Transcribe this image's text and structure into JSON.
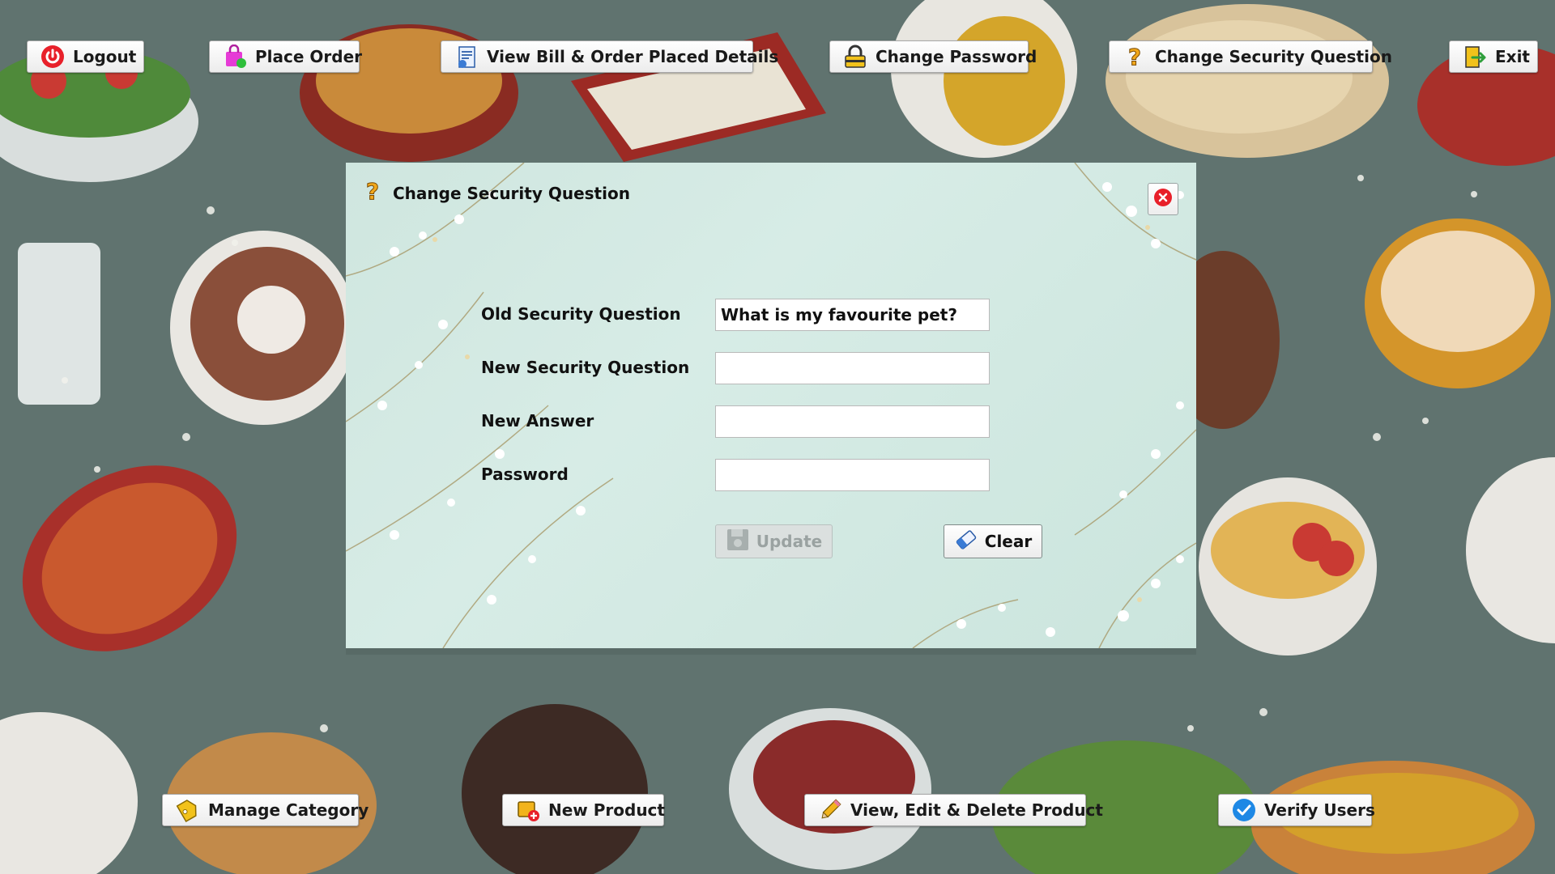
{
  "toolbar": {
    "logout_label": "Logout",
    "place_order_label": "Place Order",
    "view_bill_label": "View Bill & Order Placed Details",
    "change_password_label": "Change Password",
    "change_security_label": "Change Security Question",
    "exit_label": "Exit"
  },
  "bottom_bar": {
    "manage_category_label": "Manage Category",
    "new_product_label": "New Product",
    "view_edit_delete_label": "View, Edit & Delete Product",
    "verify_users_label": "Verify Users"
  },
  "dialog": {
    "title": "Change Security Question",
    "old_question_label": "Old Security Question",
    "old_question_value": "What is my favourite pet?",
    "new_question_label": "New Security Question",
    "new_question_value": "",
    "new_answer_label": "New Answer",
    "new_answer_value": "",
    "password_label": "Password",
    "password_value": "",
    "update_label": "Update",
    "clear_label": "Clear"
  },
  "icons": {
    "logout": "power-icon",
    "place_order": "shopping-bag-icon",
    "view_bill": "bill-icon",
    "change_password": "lock-icon",
    "change_security": "question-mark-icon",
    "exit": "exit-door-icon",
    "close": "close-icon",
    "update": "floppy-disk-icon",
    "clear": "eraser-icon",
    "manage_category": "tag-icon",
    "new_product": "new-product-icon",
    "view_edit_delete": "pencil-icon",
    "verify_users": "checkmark-icon"
  },
  "colors": {
    "accent_red": "#e8202a",
    "dialog_bg": "#d3e9e2",
    "page_bg": "#5f7471"
  }
}
